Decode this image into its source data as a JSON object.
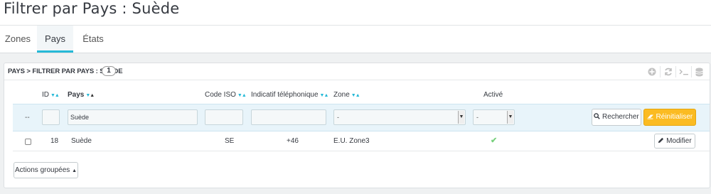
{
  "page": {
    "title": "Filtrer par Pays : Suède"
  },
  "tabs": [
    {
      "label": "Zones",
      "active": false
    },
    {
      "label": "Pays",
      "active": true
    },
    {
      "label": "États",
      "active": false
    }
  ],
  "panel": {
    "breadcrumb": "PAYS > FILTRER PAR PAYS : SUÈDE",
    "count": "1",
    "tool_icons": [
      "add-new-icon",
      "refresh-icon",
      "sql-query-icon",
      "database-export-icon"
    ]
  },
  "table": {
    "headers": {
      "id": "ID",
      "pays": "Pays",
      "iso": "Code ISO",
      "phone": "Indicatif téléphonique",
      "zone": "Zone",
      "active": "Activé"
    },
    "filters": {
      "bulk_placeholder": "--",
      "id": "",
      "pays": "Suède",
      "iso": "",
      "phone": "",
      "zone": "-",
      "active": "-"
    },
    "search_label": "Rechercher",
    "reset_label": "Réinitialiser",
    "rows": [
      {
        "id": "18",
        "pays": "Suède",
        "iso": "SE",
        "phone": "+46",
        "zone": "E.U. Zone3",
        "active": true,
        "edit_label": "Modifier"
      }
    ]
  },
  "bulk_actions_label": "Actions groupées",
  "colors": {
    "accent": "#25b9d7",
    "warning": "#fbbb22",
    "success": "#78d07d"
  }
}
